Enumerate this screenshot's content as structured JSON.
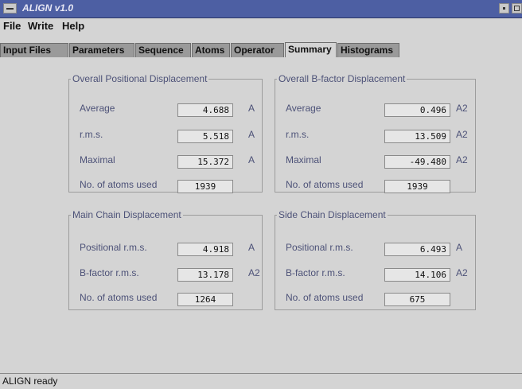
{
  "window": {
    "title": "ALIGN v1.0"
  },
  "menu": [
    "File",
    "Write",
    "Help"
  ],
  "tabs": [
    {
      "label": "Input Files",
      "active": false
    },
    {
      "label": "Parameters",
      "active": false
    },
    {
      "label": "Sequence",
      "active": false
    },
    {
      "label": "Atoms",
      "active": false
    },
    {
      "label": "Operator",
      "active": false
    },
    {
      "label": "Summary",
      "active": true
    },
    {
      "label": "Histograms",
      "active": false
    }
  ],
  "groups": {
    "overall_positional": {
      "title": "Overall Positional Displacement",
      "rows": [
        {
          "label": "Average",
          "value": "4.688",
          "unit": "A"
        },
        {
          "label": "r.m.s.",
          "value": "5.518",
          "unit": "A"
        },
        {
          "label": "Maximal",
          "value": "15.372",
          "unit": "A"
        },
        {
          "label": "No. of atoms used",
          "value": "1939",
          "unit": ""
        }
      ]
    },
    "overall_bfactor": {
      "title": "Overall B-factor Displacement",
      "rows": [
        {
          "label": "Average",
          "value": "0.496",
          "unit": "A2"
        },
        {
          "label": "r.m.s.",
          "value": "13.509",
          "unit": "A2"
        },
        {
          "label": "Maximal",
          "value": "-49.480",
          "unit": "A2"
        },
        {
          "label": "No. of atoms used",
          "value": "1939",
          "unit": ""
        }
      ]
    },
    "main_chain": {
      "title": "Main Chain Displacement",
      "rows": [
        {
          "label": "Positional r.m.s.",
          "value": "4.918",
          "unit": "A"
        },
        {
          "label": "B-factor r.m.s.",
          "value": "13.178",
          "unit": "A2"
        },
        {
          "label": "No. of atoms used",
          "value": "1264",
          "unit": ""
        }
      ]
    },
    "side_chain": {
      "title": "Side Chain Displacement",
      "rows": [
        {
          "label": "Positional r.m.s.",
          "value": "6.493",
          "unit": "A"
        },
        {
          "label": "B-factor r.m.s.",
          "value": "14.106",
          "unit": "A2"
        },
        {
          "label": "No. of atoms used",
          "value": "675",
          "unit": ""
        }
      ]
    }
  },
  "status": {
    "text": "ALIGN ready"
  },
  "colors": {
    "titlebar": "#4d5fa3",
    "background": "#d4d4d4",
    "label_text": "#4d5278",
    "inactive_tab": "#9a9a9a"
  }
}
